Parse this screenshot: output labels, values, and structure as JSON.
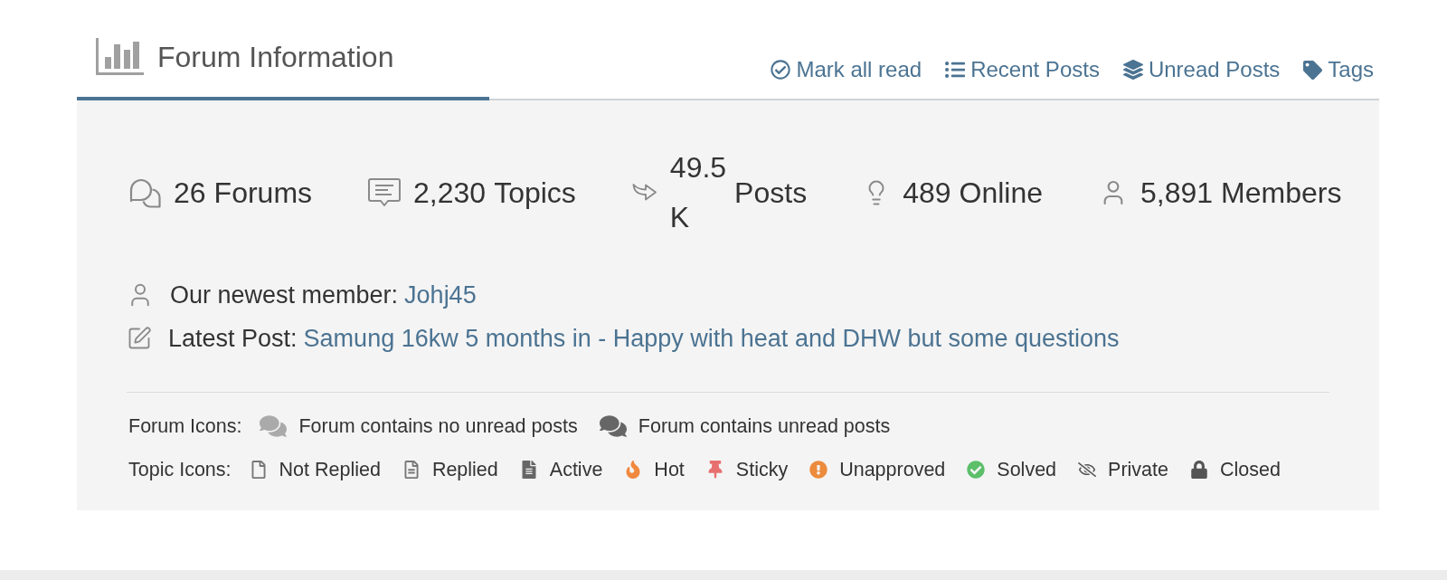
{
  "section": {
    "title": "Forum Information"
  },
  "actions": [
    {
      "kind": "mark-read",
      "label": "Mark all read"
    },
    {
      "kind": "recent",
      "label": "Recent Posts"
    },
    {
      "kind": "unread",
      "label": "Unread Posts"
    },
    {
      "kind": "tags",
      "label": "Tags"
    }
  ],
  "stats": [
    {
      "kind": "forums",
      "value": "26",
      "label": "Forums"
    },
    {
      "kind": "topics",
      "value": "2,230",
      "label": "Topics"
    },
    {
      "kind": "posts",
      "value": "49.5 K",
      "label": "Posts"
    },
    {
      "kind": "online",
      "value": "489",
      "label": "Online"
    },
    {
      "kind": "members",
      "value": "5,891",
      "label": "Members"
    }
  ],
  "info": [
    {
      "kind": "member",
      "label": "Our newest member:",
      "link": "Johj45"
    },
    {
      "kind": "post",
      "label": "Latest Post:",
      "link": "Samung 16kw 5 months in - Happy with heat and DHW but some questions"
    }
  ],
  "forum_icons": {
    "label": "Forum Icons:",
    "items": [
      {
        "unread": false,
        "label": "Forum contains no unread posts"
      },
      {
        "unread": true,
        "label": "Forum contains unread posts"
      }
    ]
  },
  "topic_icons": {
    "label": "Topic Icons:",
    "items": [
      {
        "kind": "not-replied",
        "color": "#777777",
        "label": "Not Replied"
      },
      {
        "kind": "replied",
        "color": "#777777",
        "label": "Replied"
      },
      {
        "kind": "active",
        "color": "#666666",
        "label": "Active"
      },
      {
        "kind": "hot",
        "color": "#f0883e",
        "label": "Hot"
      },
      {
        "kind": "sticky",
        "color": "#e86f6f",
        "label": "Sticky"
      },
      {
        "kind": "unapproved",
        "color": "#ec8b3c",
        "label": "Unapproved"
      },
      {
        "kind": "solved",
        "color": "#5cbf6a",
        "label": "Solved"
      },
      {
        "kind": "private",
        "color": "#555555",
        "label": "Private"
      },
      {
        "kind": "closed",
        "color": "#555555",
        "label": "Closed"
      }
    ]
  }
}
